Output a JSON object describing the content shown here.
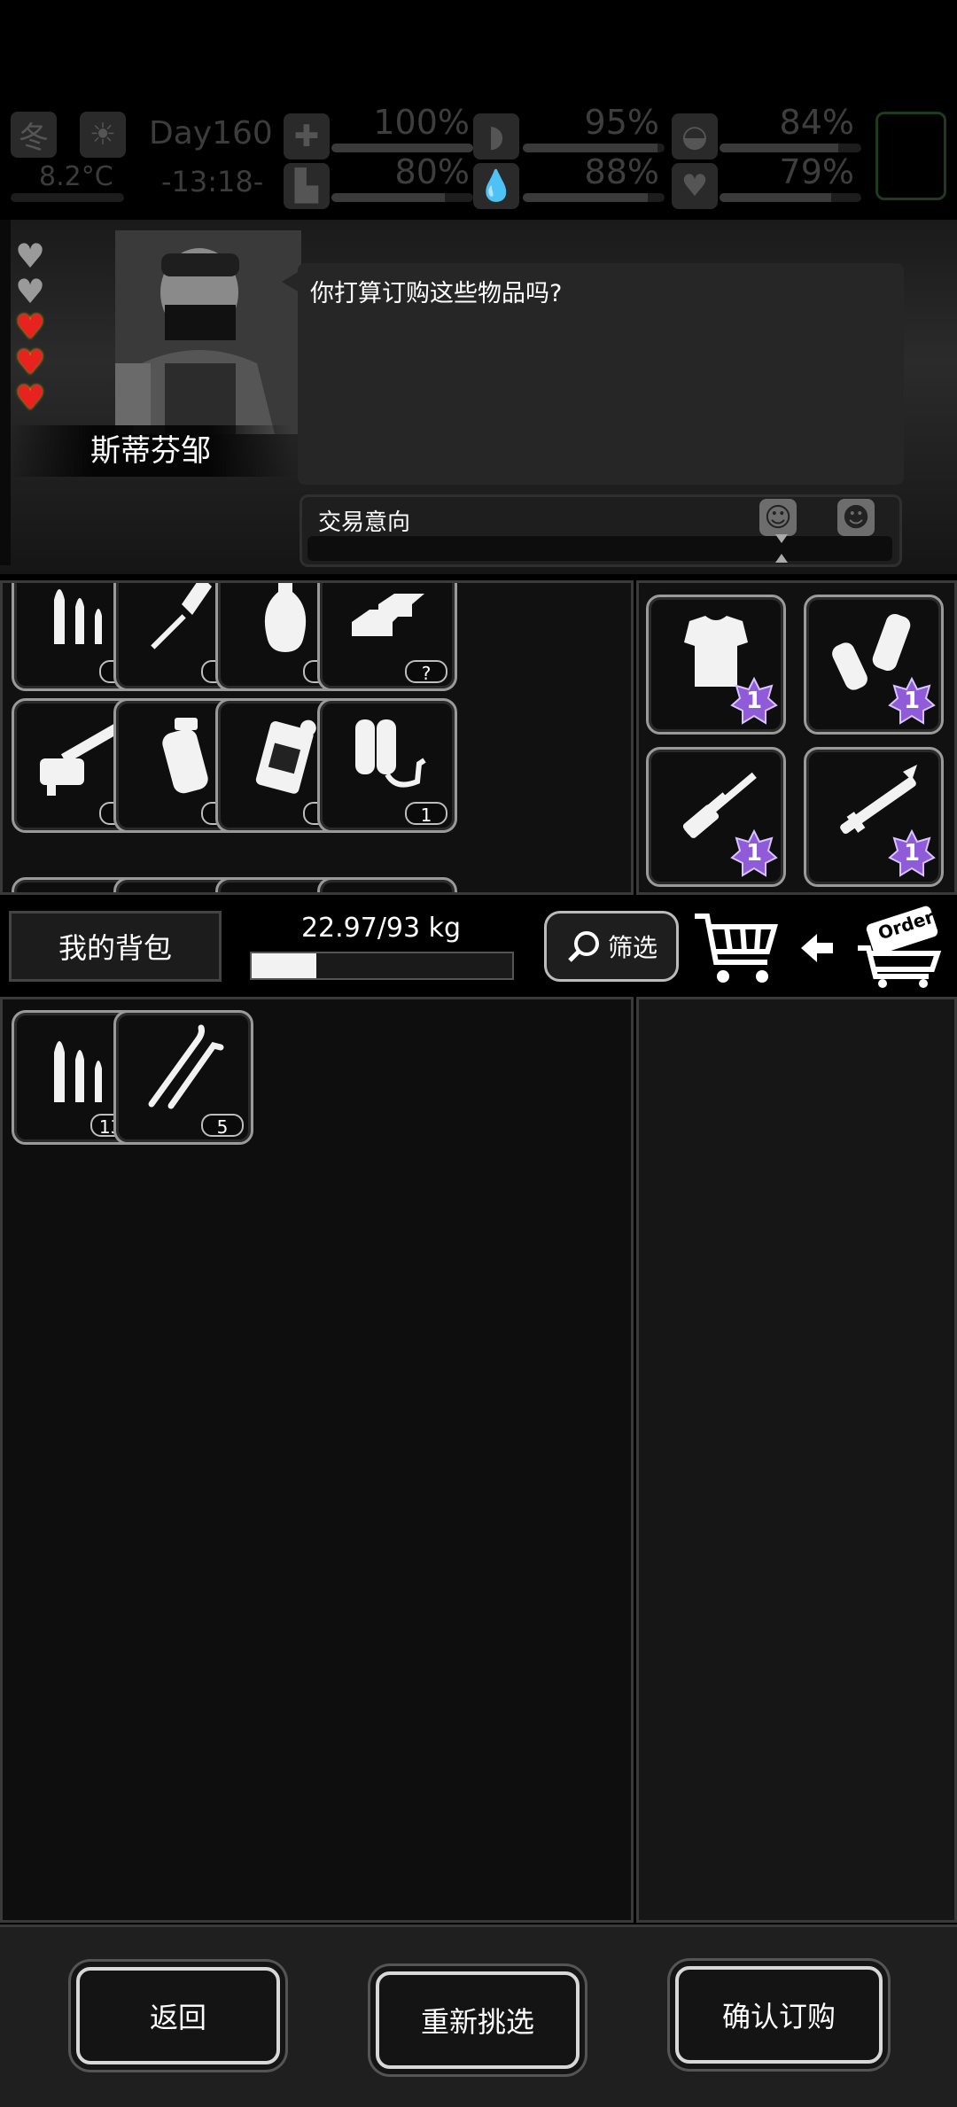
{
  "status": {
    "season": "冬",
    "temperature": "8.2°C",
    "day": "Day160",
    "time": "-13:18-",
    "stats": [
      {
        "icon": "health-kit-icon",
        "value": "100%",
        "level": 1.0
      },
      {
        "icon": "stomach-icon",
        "value": "95%",
        "level": 0.95
      },
      {
        "icon": "pill-icon",
        "value": "84%",
        "level": 0.84
      },
      {
        "icon": "boot-icon",
        "value": "80%",
        "level": 0.8
      },
      {
        "icon": "water-drop-icon",
        "value": "88%",
        "level": 0.88
      },
      {
        "icon": "heart-icon",
        "value": "79%",
        "level": 0.79
      }
    ]
  },
  "npc": {
    "name": "斯蒂芬邹",
    "hearts_total": 5,
    "hearts_filled": 3,
    "dialog": "你打算订购这些物品吗?",
    "trade_label": "交易意向"
  },
  "shop_items": [
    {
      "icon": "bullets-icon",
      "qty": "?"
    },
    {
      "icon": "rpg-rocket-icon",
      "qty": "?"
    },
    {
      "icon": "vase-icon",
      "qty": "?"
    },
    {
      "icon": "gold-bars-icon",
      "qty": "?"
    },
    {
      "icon": "minigun-icon",
      "qty": "1"
    },
    {
      "icon": "grenade-icon",
      "qty": "?"
    },
    {
      "icon": "fuel-canister-icon",
      "qty": "?"
    },
    {
      "icon": "flamethrower-icon",
      "qty": "1"
    }
  ],
  "cart_items": [
    {
      "icon": "body-armor-icon",
      "badge": "1"
    },
    {
      "icon": "arm-guards-icon",
      "badge": "1"
    },
    {
      "icon": "sniper-rifle-icon",
      "badge": "1"
    },
    {
      "icon": "rocket-launcher-icon",
      "badge": "1"
    }
  ],
  "toolbar": {
    "bag_label": "我的背包",
    "weight": "22.97/93 kg",
    "weight_fraction": 0.247,
    "filter_label": "筛选",
    "order_tag": "Order"
  },
  "inventory": [
    {
      "icon": "bullets-icon",
      "qty": "130"
    },
    {
      "icon": "lockpick-icon",
      "qty": "5"
    }
  ],
  "buttons": {
    "back": "返回",
    "reselect": "重新挑选",
    "confirm": "确认订购"
  }
}
